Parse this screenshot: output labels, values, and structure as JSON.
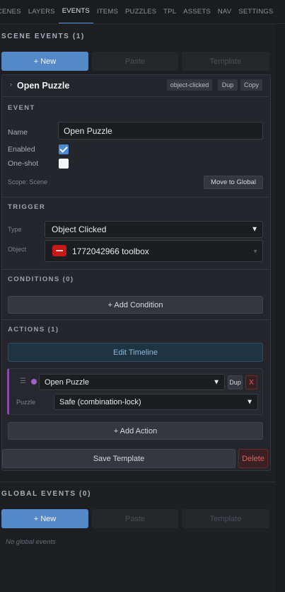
{
  "tabs": [
    {
      "label": "CENES",
      "active": false
    },
    {
      "label": "LAYERS",
      "active": false
    },
    {
      "label": "EVENTS",
      "active": true
    },
    {
      "label": "ITEMS",
      "active": false
    },
    {
      "label": "PUZZLES",
      "active": false
    },
    {
      "label": "TPL",
      "active": false
    },
    {
      "label": "ASSETS",
      "active": false
    },
    {
      "label": "NAV",
      "active": false
    },
    {
      "label": "SETTINGS",
      "active": false
    }
  ],
  "scene_events": {
    "title": "SCENE EVENTS (1)",
    "new_label": "+ New",
    "paste_label": "Paste",
    "template_label": "Template"
  },
  "event": {
    "title": "Open Puzzle",
    "trigger_badge": "object-clicked",
    "dup_label": "Dup",
    "copy_label": "Copy",
    "section_event": "EVENT",
    "name_label": "Name",
    "name_value": "Open Puzzle",
    "enabled_label": "Enabled",
    "enabled": true,
    "oneshot_label": "One-shot",
    "oneshot": false,
    "scope_text": "Scope: Scene",
    "move_global_label": "Move to Global",
    "section_trigger": "TRIGGER",
    "type_label": "Type",
    "type_value": "Object Clicked",
    "object_label": "Object",
    "object_value": "1772042966 toolbox",
    "section_conditions": "CONDITIONS (0)",
    "add_condition_label": "+ Add Condition",
    "section_actions": "ACTIONS (1)",
    "edit_timeline_label": "Edit Timeline",
    "action": {
      "type_value": "Open Puzzle",
      "dup_label": "Dup",
      "remove_label": "X",
      "puzzle_label": "Puzzle",
      "puzzle_value": "Safe (combination-lock)"
    },
    "add_action_label": "+ Add Action",
    "save_template_label": "Save Template",
    "delete_label": "Delete"
  },
  "global_events": {
    "title": "GLOBAL EVENTS (0)",
    "new_label": "+ New",
    "paste_label": "Paste",
    "template_label": "Template",
    "empty_text": "No global events"
  },
  "colors": {
    "accent": "#5588c8",
    "action_marker": "#a060c8",
    "danger": "#e06060",
    "object_icon": "#c81818"
  }
}
